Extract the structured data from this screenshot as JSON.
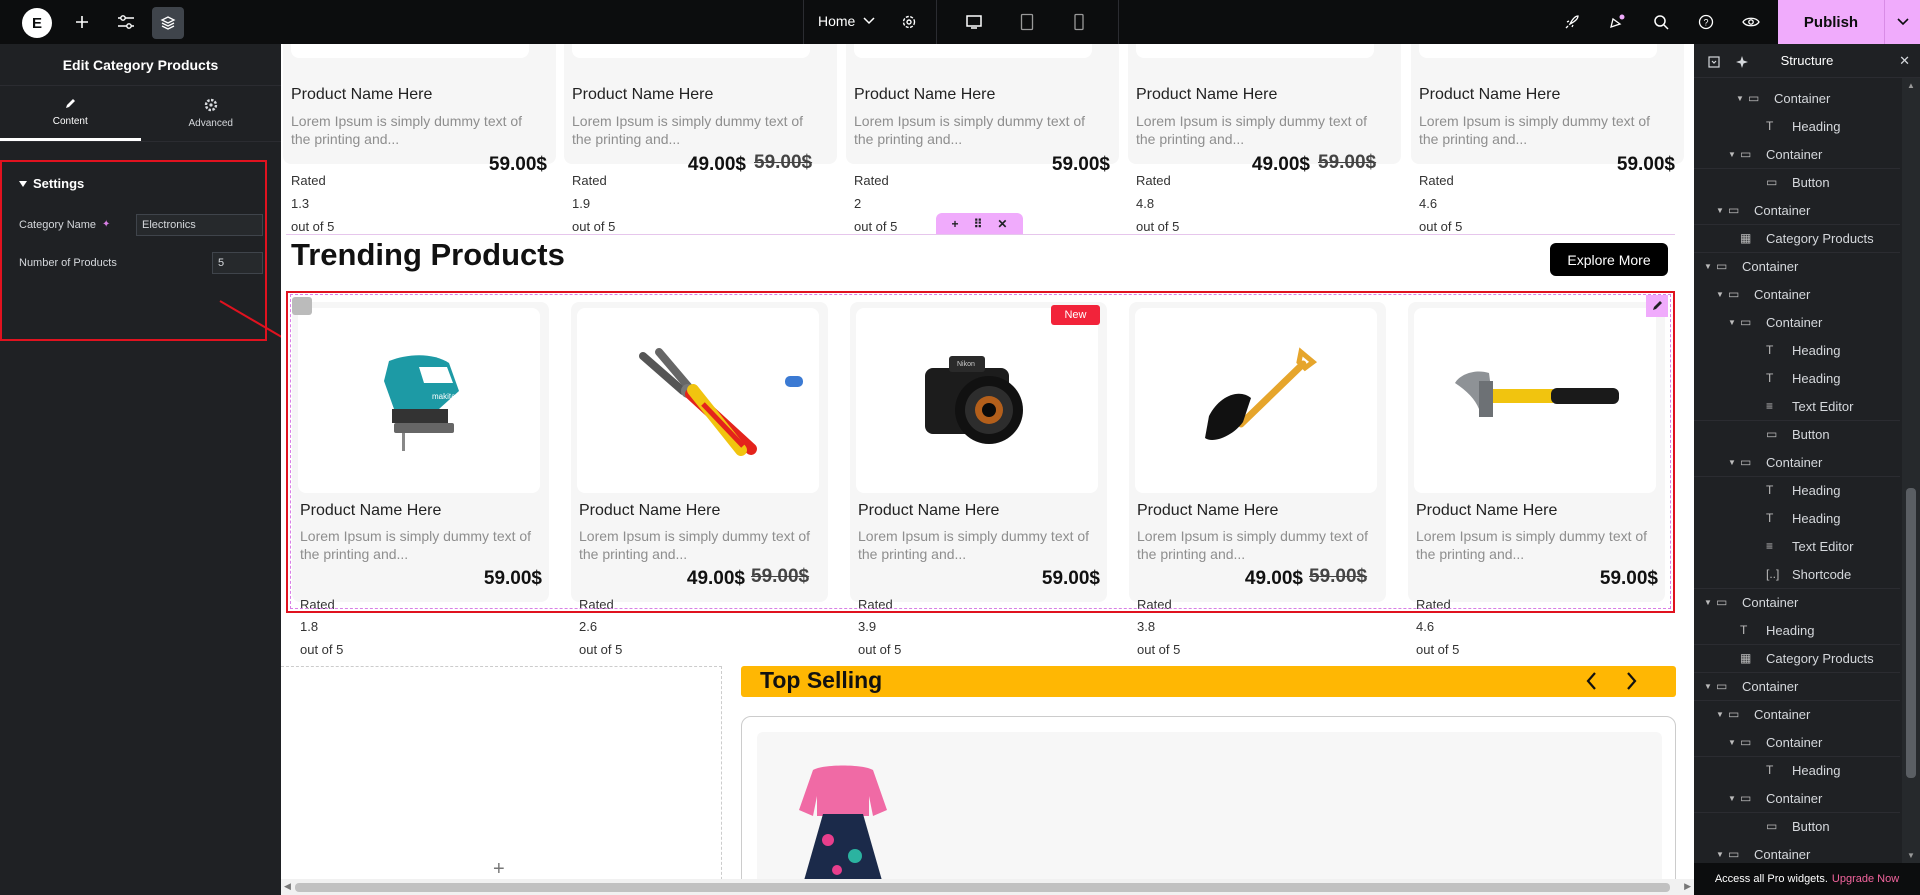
{
  "topbar": {
    "page_name": "Home",
    "publish_label": "Publish",
    "icons": [
      "elementor-logo-icon",
      "plus-icon",
      "sliders-icon",
      "layers-icon",
      "gear-icon",
      "desktop-icon",
      "tablet-icon",
      "mobile-icon",
      "rocket-icon",
      "notifications-icon",
      "search-icon",
      "help-icon",
      "eye-icon",
      "chevron-down-icon"
    ]
  },
  "left_panel": {
    "title": "Edit Category Products",
    "tabs": [
      {
        "label": "Content"
      },
      {
        "label": "Advanced"
      }
    ],
    "section": "Settings",
    "category_label": "Category Name",
    "category_value": "Electronics",
    "number_label": "Number of Products",
    "number_value": "5"
  },
  "canvas": {
    "top_row": [
      {
        "name": "Product Name Here",
        "desc1": "Lorem Ipsum is simply dummy text of",
        "desc2": "the printing and...",
        "price": "59.00$",
        "old_price": "",
        "rated": "Rated",
        "rating": "1.3",
        "out_of": "out of 5"
      },
      {
        "name": "Product Name Here",
        "desc1": "Lorem Ipsum is simply dummy text of",
        "desc2": "the printing and...",
        "price": "49.00$",
        "old_price": "59.00$",
        "rated": "Rated",
        "rating": "1.9",
        "out_of": "out of 5"
      },
      {
        "name": "Product Name Here",
        "desc1": "Lorem Ipsum is simply dummy text of",
        "desc2": "the printing and...",
        "price": "59.00$",
        "old_price": "",
        "rated": "Rated",
        "rating": "2",
        "out_of": "out of 5"
      },
      {
        "name": "Product Name Here",
        "desc1": "Lorem Ipsum is simply dummy text of",
        "desc2": "the printing and...",
        "price": "49.00$",
        "old_price": "59.00$",
        "rated": "Rated",
        "rating": "4.8",
        "out_of": "out of 5"
      },
      {
        "name": "Product Name Here",
        "desc1": "Lorem Ipsum is simply dummy text of",
        "desc2": "the printing and...",
        "price": "59.00$",
        "old_price": "",
        "rated": "Rated",
        "rating": "4.6",
        "out_of": "out of 5"
      }
    ],
    "trending_title": "Trending Products",
    "explore_label": "Explore More",
    "new_badge": "New",
    "trending": [
      {
        "name": "Product Name Here",
        "desc1": "Lorem Ipsum is simply dummy text of",
        "desc2": "the printing and...",
        "price": "59.00$",
        "old_price": "",
        "rated": "Rated",
        "rating": "1.8",
        "out_of": "out of 5",
        "image": "jigsaw-icon"
      },
      {
        "name": "Product Name Here",
        "desc1": "Lorem Ipsum is simply dummy text of",
        "desc2": "the printing and...",
        "price": "49.00$",
        "old_price": "59.00$",
        "rated": "Rated",
        "rating": "2.6",
        "out_of": "out of 5",
        "image": "pliers-icon"
      },
      {
        "name": "Product Name Here",
        "desc1": "Lorem Ipsum is simply dummy text of",
        "desc2": "the printing and...",
        "price": "59.00$",
        "old_price": "",
        "rated": "Rated",
        "rating": "3.9",
        "out_of": "out of 5",
        "image": "camera-icon"
      },
      {
        "name": "Product Name Here",
        "desc1": "Lorem Ipsum is simply dummy text of",
        "desc2": "the printing and...",
        "price": "49.00$",
        "old_price": "59.00$",
        "rated": "Rated",
        "rating": "3.8",
        "out_of": "out of 5",
        "image": "shovel-icon"
      },
      {
        "name": "Product Name Here",
        "desc1": "Lorem Ipsum is simply dummy text of",
        "desc2": "the printing and...",
        "price": "59.00$",
        "old_price": "",
        "rated": "Rated",
        "rating": "4.6",
        "out_of": "out of 5",
        "image": "hammer-icon"
      }
    ],
    "top_selling_title": "Top Selling"
  },
  "right_panel": {
    "title": "Structure",
    "tree": [
      {
        "label": "Container",
        "kind": "container",
        "expanded": true
      },
      {
        "label": "Heading",
        "kind": "heading"
      },
      {
        "label": "Container",
        "kind": "container",
        "expanded": true
      },
      {
        "label": "Button",
        "kind": "button"
      },
      {
        "label": "Container",
        "kind": "container",
        "expanded": true
      },
      {
        "label": "Category Products",
        "kind": "grid"
      },
      {
        "label": "Container",
        "kind": "container",
        "expanded": true
      },
      {
        "label": "Container",
        "kind": "container",
        "expanded": true
      },
      {
        "label": "Container",
        "kind": "container",
        "expanded": true
      },
      {
        "label": "Heading",
        "kind": "heading"
      },
      {
        "label": "Heading",
        "kind": "heading"
      },
      {
        "label": "Text Editor",
        "kind": "text"
      },
      {
        "label": "Button",
        "kind": "button"
      },
      {
        "label": "Container",
        "kind": "container",
        "expanded": true
      },
      {
        "label": "Heading",
        "kind": "heading"
      },
      {
        "label": "Heading",
        "kind": "heading"
      },
      {
        "label": "Text Editor",
        "kind": "text"
      },
      {
        "label": "Shortcode",
        "kind": "shortcode"
      },
      {
        "label": "Container",
        "kind": "container",
        "expanded": true
      },
      {
        "label": "Heading",
        "kind": "heading"
      },
      {
        "label": "Category Products",
        "kind": "grid"
      },
      {
        "label": "Container",
        "kind": "container",
        "expanded": true
      },
      {
        "label": "Container",
        "kind": "container",
        "expanded": true
      },
      {
        "label": "Container",
        "kind": "container",
        "expanded": true
      },
      {
        "label": "Heading",
        "kind": "heading"
      },
      {
        "label": "Container",
        "kind": "container",
        "expanded": true
      },
      {
        "label": "Button",
        "kind": "button"
      },
      {
        "label": "Container",
        "kind": "container",
        "expanded": true
      }
    ],
    "pro_text": "Access all Pro widgets.",
    "upgrade_label": "Upgrade Now"
  }
}
